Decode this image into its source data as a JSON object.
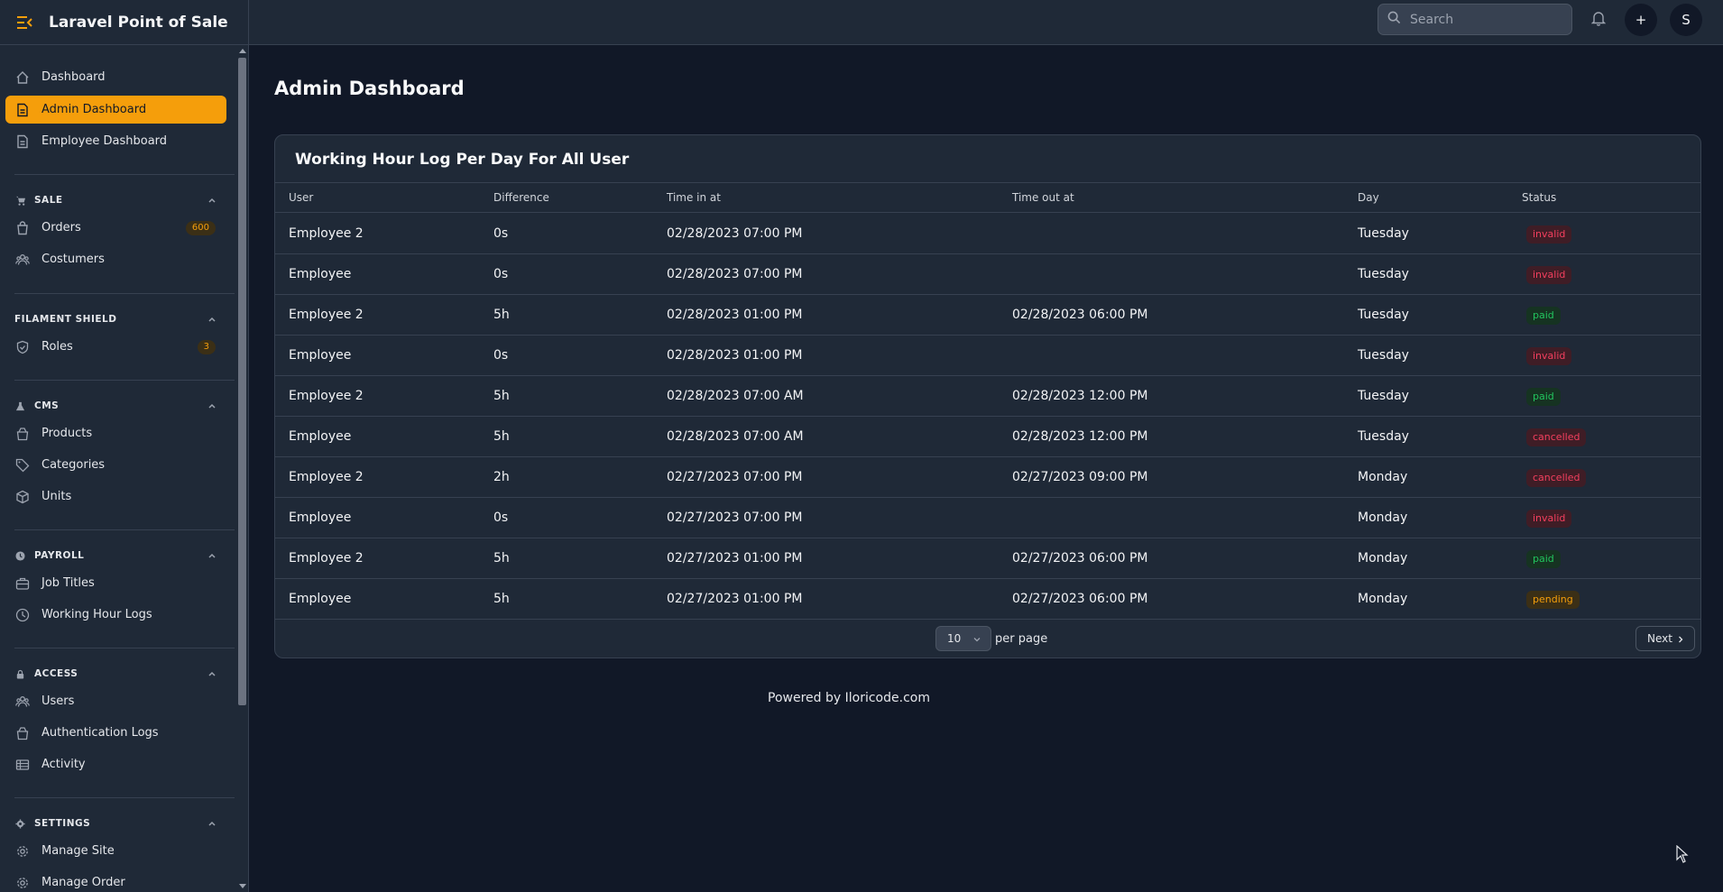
{
  "app": {
    "title": "Laravel Point of Sale",
    "accent_color": "#f59e0b",
    "menu_icon": "menu-collapse-icon"
  },
  "header": {
    "search_placeholder": "Search",
    "notification_icon": "bell-icon",
    "add_label": "+",
    "avatar_initial": "S"
  },
  "sidebar": {
    "top_items": [
      {
        "label": "Dashboard",
        "icon": "home-icon"
      },
      {
        "label": "Admin Dashboard",
        "icon": "document-icon",
        "active": true
      },
      {
        "label": "Employee Dashboard",
        "icon": "document-icon"
      }
    ],
    "groups": [
      {
        "label": "SALE",
        "icon": "cart-icon",
        "items": [
          {
            "label": "Orders",
            "icon": "bag-icon",
            "badge": "600"
          },
          {
            "label": "Costumers",
            "icon": "users-icon"
          }
        ]
      },
      {
        "label": "FILAMENT SHIELD",
        "icon": "",
        "items": [
          {
            "label": "Roles",
            "icon": "shield-check-icon",
            "badge": "3"
          }
        ]
      },
      {
        "label": "CMS",
        "icon": "flask-icon",
        "items": [
          {
            "label": "Products",
            "icon": "bag-icon"
          },
          {
            "label": "Categories",
            "icon": "tag-icon"
          },
          {
            "label": "Units",
            "icon": "cube-icon"
          }
        ]
      },
      {
        "label": "PAYROLL",
        "icon": "clock-solid-icon",
        "items": [
          {
            "label": "Job Titles",
            "icon": "briefcase-icon"
          },
          {
            "label": "Working Hour Logs",
            "icon": "clock-icon"
          }
        ]
      },
      {
        "label": "ACCESS",
        "icon": "lock-icon",
        "items": [
          {
            "label": "Users",
            "icon": "users-icon"
          },
          {
            "label": "Authentication Logs",
            "icon": "bag-icon"
          },
          {
            "label": "Activity",
            "icon": "table-icon"
          }
        ]
      },
      {
        "label": "SETTINGS",
        "icon": "cog-solid-icon",
        "items": [
          {
            "label": "Manage Site",
            "icon": "cog-icon"
          },
          {
            "label": "Manage Order",
            "icon": "cog-icon"
          }
        ]
      }
    ]
  },
  "main": {
    "page_title": "Admin Dashboard",
    "card_title": "Working Hour Log Per Day For All User",
    "columns": [
      "User",
      "Difference",
      "Time in at",
      "Time out at",
      "Day",
      "Status"
    ],
    "rows": [
      {
        "user": "Employee 2",
        "difference": "0s",
        "time_in": "02/28/2023 07:00 PM",
        "time_out": "",
        "day": "Tuesday",
        "status": "invalid"
      },
      {
        "user": "Employee",
        "difference": "0s",
        "time_in": "02/28/2023 07:00 PM",
        "time_out": "",
        "day": "Tuesday",
        "status": "invalid"
      },
      {
        "user": "Employee 2",
        "difference": "5h",
        "time_in": "02/28/2023 01:00 PM",
        "time_out": "02/28/2023 06:00 PM",
        "day": "Tuesday",
        "status": "paid"
      },
      {
        "user": "Employee",
        "difference": "0s",
        "time_in": "02/28/2023 01:00 PM",
        "time_out": "",
        "day": "Tuesday",
        "status": "invalid"
      },
      {
        "user": "Employee 2",
        "difference": "5h",
        "time_in": "02/28/2023 07:00 AM",
        "time_out": "02/28/2023 12:00 PM",
        "day": "Tuesday",
        "status": "paid"
      },
      {
        "user": "Employee",
        "difference": "5h",
        "time_in": "02/28/2023 07:00 AM",
        "time_out": "02/28/2023 12:00 PM",
        "day": "Tuesday",
        "status": "cancelled"
      },
      {
        "user": "Employee 2",
        "difference": "2h",
        "time_in": "02/27/2023 07:00 PM",
        "time_out": "02/27/2023 09:00 PM",
        "day": "Monday",
        "status": "cancelled"
      },
      {
        "user": "Employee",
        "difference": "0s",
        "time_in": "02/27/2023 07:00 PM",
        "time_out": "",
        "day": "Monday",
        "status": "invalid"
      },
      {
        "user": "Employee 2",
        "difference": "5h",
        "time_in": "02/27/2023 01:00 PM",
        "time_out": "02/27/2023 06:00 PM",
        "day": "Monday",
        "status": "paid"
      },
      {
        "user": "Employee",
        "difference": "5h",
        "time_in": "02/27/2023 01:00 PM",
        "time_out": "02/27/2023 06:00 PM",
        "day": "Monday",
        "status": "pending"
      }
    ],
    "pagination": {
      "per_page_value": "10",
      "per_page_label": "per page",
      "next_label": "Next"
    },
    "footer": "Powered by Iloricode.com"
  }
}
